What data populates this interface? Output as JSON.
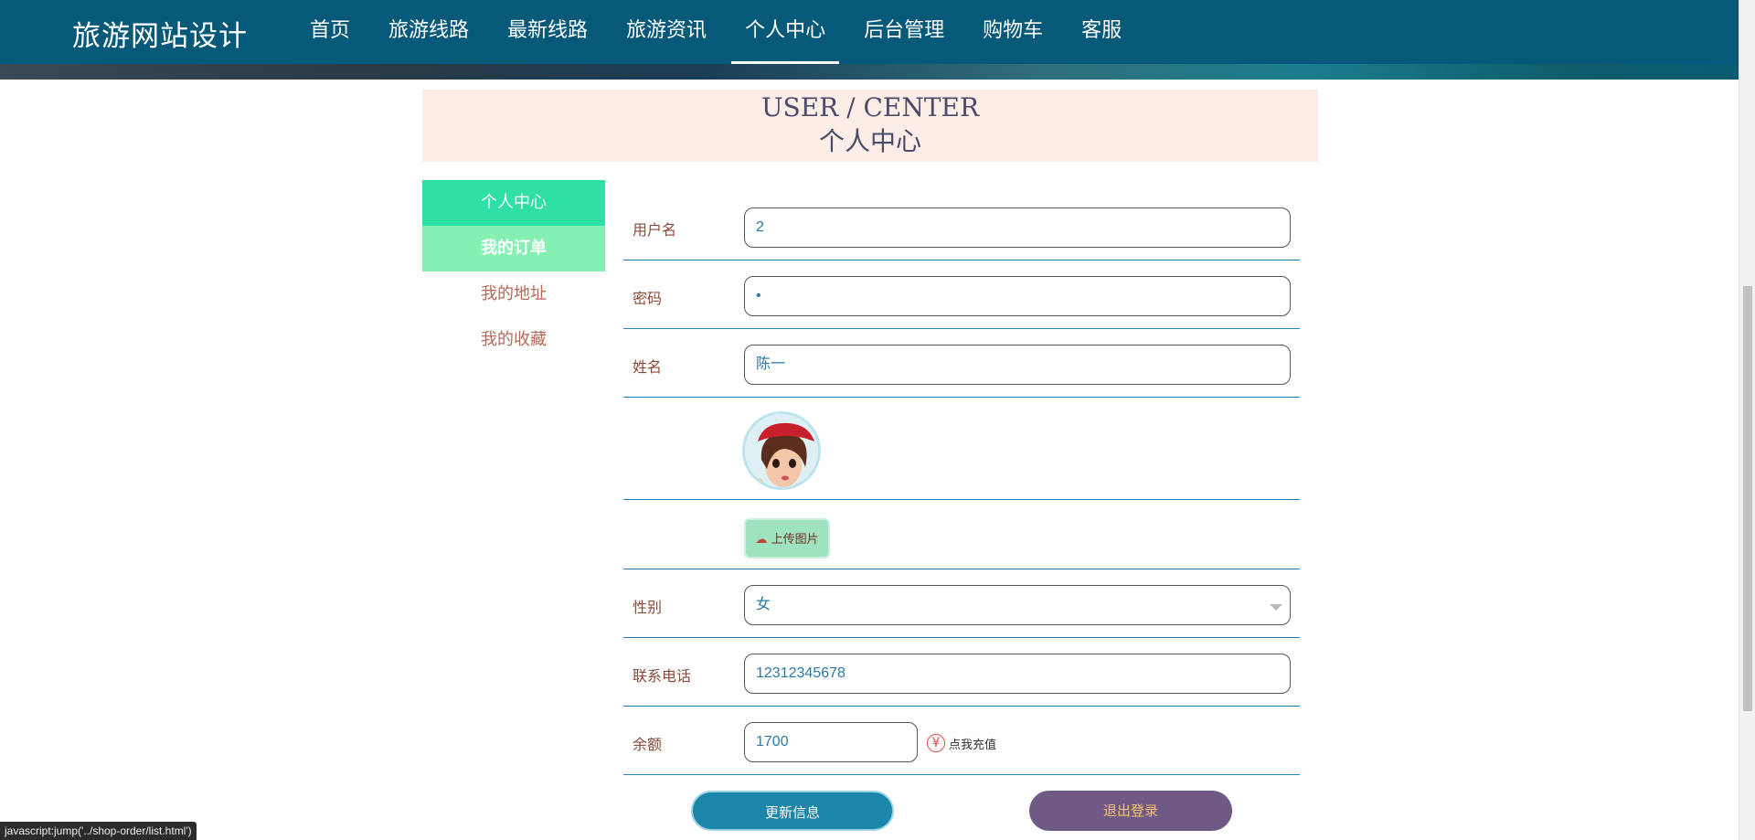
{
  "header": {
    "brand": "旅游网站设计",
    "nav": [
      {
        "label": "首页"
      },
      {
        "label": "旅游线路"
      },
      {
        "label": "最新线路"
      },
      {
        "label": "旅游资讯"
      },
      {
        "label": "个人中心"
      },
      {
        "label": "后台管理"
      },
      {
        "label": "购物车"
      },
      {
        "label": "客服"
      }
    ],
    "active_nav": "个人中心"
  },
  "title": {
    "en": "USER / CENTER",
    "zh": "个人中心"
  },
  "sidebar": {
    "items": [
      {
        "label": "个人中心"
      },
      {
        "label": "我的订单"
      },
      {
        "label": "我的地址"
      },
      {
        "label": "我的收藏"
      }
    ]
  },
  "form": {
    "username": {
      "label": "用户名",
      "value": "2"
    },
    "password": {
      "label": "密码",
      "value": "•"
    },
    "name": {
      "label": "姓名",
      "value": "陈一"
    },
    "avatar": {
      "icon": "avatar-image"
    },
    "upload": {
      "label": "上传图片",
      "icon": "cloud-upload-icon"
    },
    "gender": {
      "label": "性别",
      "value": "女"
    },
    "phone": {
      "label": "联系电话",
      "value": "12312345678"
    },
    "balance": {
      "label": "余额",
      "value": "1700",
      "recharge_label": "点我充值",
      "recharge_icon": "¥"
    }
  },
  "actions": {
    "update": "更新信息",
    "logout": "退出登录"
  },
  "status_bar": "javascript:jump('../shop-order/list.html')",
  "colors": {
    "topbar": "#07597a",
    "title_bg": "#fcede6",
    "sidebar_active": "#2fe0a6",
    "sidebar_hover": "#84f0b2",
    "line": "#1d88b8",
    "update_button": "#1b86a9",
    "logout_button": "#6e5a84"
  }
}
